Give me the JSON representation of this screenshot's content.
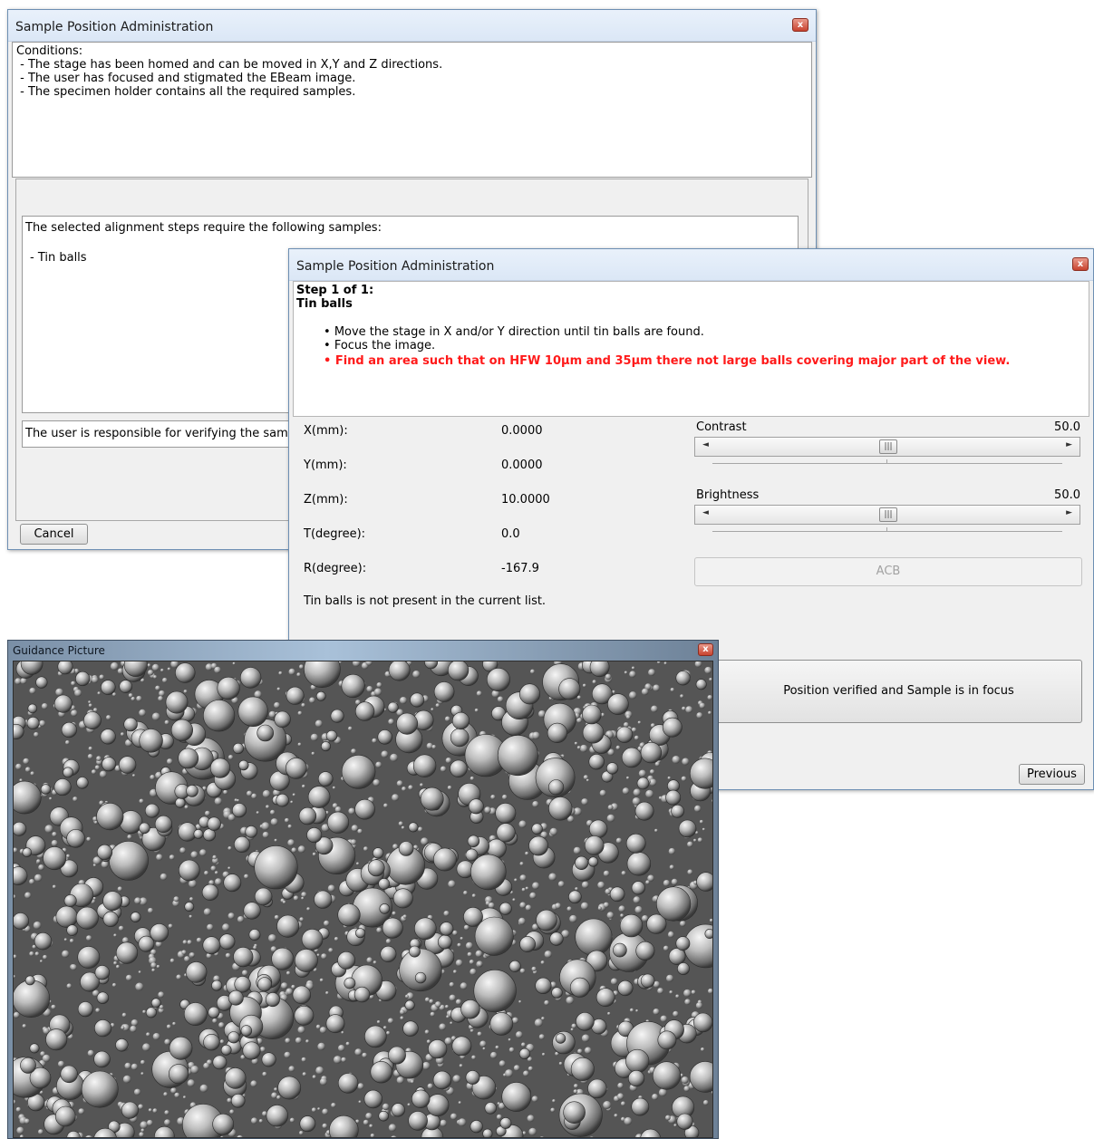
{
  "back_dialog": {
    "title": "Sample Position Administration",
    "conditions": [
      "Conditions:",
      " - The stage has been homed and can be moved in X,Y and Z directions.",
      " - The user has focused and stigmated the EBeam image.",
      " - The specimen holder contains all the required samples."
    ],
    "requirement_heading": "The selected alignment steps require the following samples:",
    "required_sample": "- Tin balls",
    "notice": "The user is responsible for verifying the samp",
    "cancel_label": "Cancel"
  },
  "front_dialog": {
    "title": "Sample Position Administration",
    "step_label": "Step 1 of 1:",
    "step_name": "Tin balls",
    "instructions": [
      "Move the stage in X and/or Y direction until tin balls are found.",
      "Focus the image."
    ],
    "warning": "Find an area such that on HFW 10µm and 35µm there not large balls covering major part of the view.",
    "coordinates": [
      {
        "label": "X(mm):",
        "value": "0.0000"
      },
      {
        "label": "Y(mm):",
        "value": "0.0000"
      },
      {
        "label": "Z(mm):",
        "value": "10.0000"
      },
      {
        "label": "T(degree):",
        "value": "0.0"
      },
      {
        "label": "R(degree):",
        "value": "-167.9"
      }
    ],
    "status_message": "Tin balls is not present in the current list.",
    "contrast": {
      "label": "Contrast",
      "value": "50.0",
      "level": 0.5
    },
    "brightness": {
      "label": "Brightness",
      "value": "50.0",
      "level": 0.5
    },
    "thumb_glyph": "|||",
    "acb_label": "ACB",
    "verify_label": "Position verified and Sample is in focus",
    "previous_label": "Previous"
  },
  "guidance": {
    "title": "Guidance Picture"
  },
  "close_glyph": "x",
  "colors": {
    "warning": "#ff1a1a",
    "title_bar": "#dbe7f6",
    "border": "#6d8fb3"
  }
}
